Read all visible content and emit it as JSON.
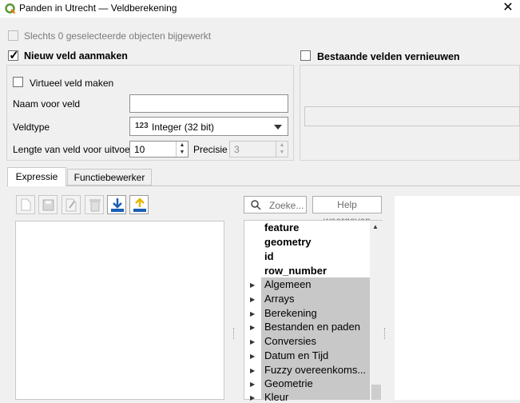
{
  "window": {
    "title": "Panden in Utrecht — Veldberekening",
    "close_glyph": "✕"
  },
  "top_checkbox": {
    "label": "Slechts 0 geselecteerde objecten bijgewerkt",
    "checked": false
  },
  "new_field": {
    "label": "Nieuw veld aanmaken",
    "checked": true,
    "virtual_label": "Virtueel veld maken",
    "name_label": "Naam voor veld",
    "name_value": "",
    "type_label": "Veldtype",
    "type_icon_text": "123",
    "type_value": "Integer (32 bit)",
    "length_label": "Lengte van veld voor uitvoer",
    "length_value": "10",
    "precision_label": "Precisie",
    "precision_value": "3"
  },
  "update_existing": {
    "label": "Bestaande velden vernieuwen",
    "checked": false
  },
  "tabs": [
    {
      "label": "Expressie",
      "active": true
    },
    {
      "label": "Functiebewerker",
      "active": false
    }
  ],
  "search": {
    "placeholder": "Zoeke..."
  },
  "help_button": "Help weergeven",
  "function_list": {
    "fields": [
      "feature",
      "geometry",
      "id",
      "row_number"
    ],
    "groups": [
      "Algemeen",
      "Arrays",
      "Berekening",
      "Bestanden en paden",
      "Conversies",
      "Datum en Tijd",
      "Fuzzy overeenkoms...",
      "Geometrie",
      "Kleur"
    ]
  },
  "colors": {
    "accent_blue": "#1a5fb4",
    "import_yellow": "#e6b800",
    "group_bg": "#c8c8c8"
  }
}
